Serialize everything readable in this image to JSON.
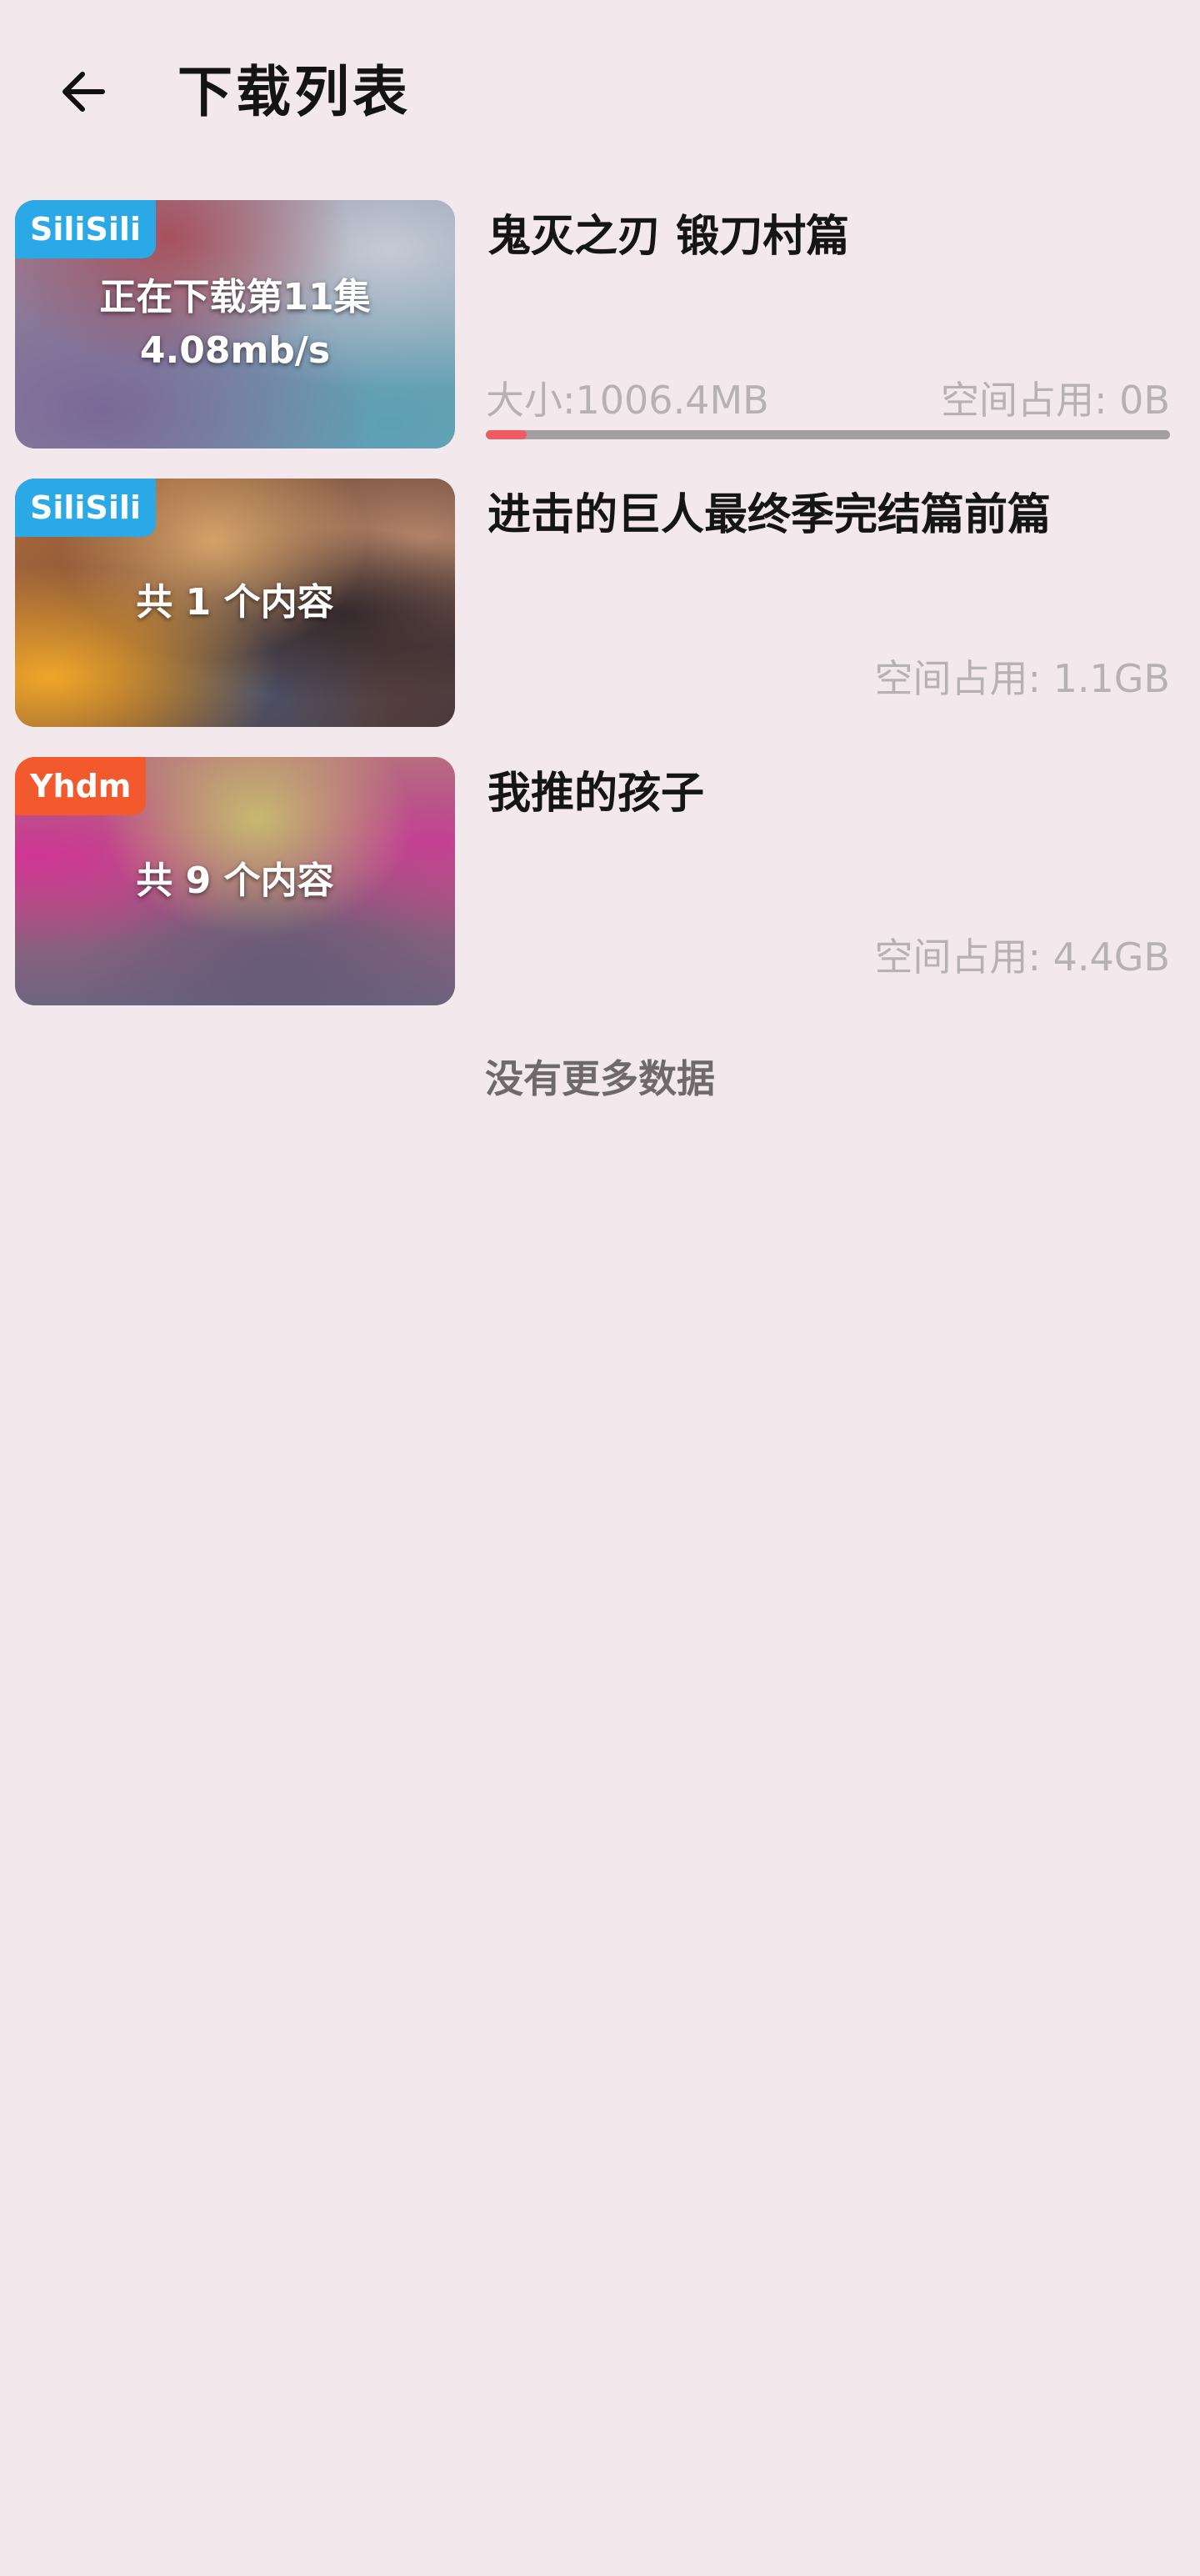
{
  "header": {
    "title": "下载列表",
    "back_icon": "arrow-left-icon"
  },
  "items": [
    {
      "badge": "SiliSili",
      "badge_color": "#2aa9e6",
      "thumb_line1": "正在下载第11集",
      "thumb_line2": "4.08mb/s",
      "title": "鬼灭之刃 锻刀村篇",
      "size": "大小:1006.4MB",
      "storage": "空间占用: 0B",
      "progress": 0.06
    },
    {
      "badge": "SiliSili",
      "badge_color": "#2aa9e6",
      "thumb_line1": "共 1 个内容",
      "title": "进击的巨人最终季完结篇前篇",
      "storage": "空间占用: 1.1GB"
    },
    {
      "badge": "Yhdm",
      "badge_color": "#f2592c",
      "thumb_line1": "共 9 个内容",
      "title": "我推的孩子",
      "storage": "空间占用: 4.4GB"
    }
  ],
  "footer": {
    "text": "没有更多数据"
  },
  "colors": {
    "background": "#f3e9ec",
    "progress_fill": "#ef5b62",
    "progress_track": "#a39fa0"
  }
}
